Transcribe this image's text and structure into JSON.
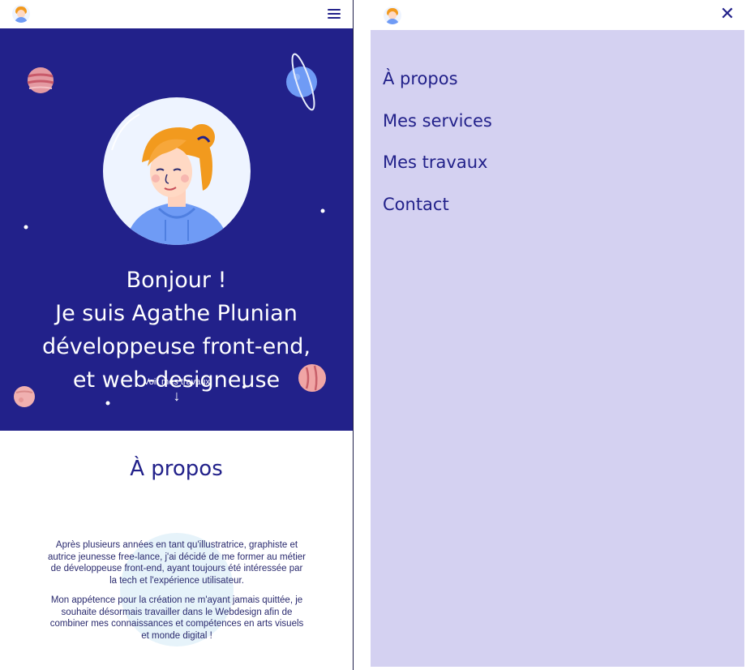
{
  "left_page": {
    "hero": {
      "lines": [
        "Bonjour !",
        "Je suis Agathe Plunian",
        "développeuse front-end,",
        "et web-designeuse"
      ],
      "cta_label": "Voir mes travaux",
      "cta_arrow": "↓"
    },
    "about": {
      "title": "À propos",
      "paragraphs": [
        "Après plusieurs années en tant qu'illustratrice, graphiste et autrice jeunesse free-lance, j'ai décidé de me former au métier de développeuse front-end, ayant toujours été intéressée par la tech et l'expérience utilisateur.",
        "Mon appétence pour la création ne m'ayant jamais quittée, je souhaite désormais travailler dans le Webdesign afin de combiner mes connaissances et compétences en arts visuels et monde digital !"
      ]
    }
  },
  "right_menu": {
    "close_icon": "✕",
    "items": [
      "À propos",
      "Mes services",
      "Mes travaux",
      "Contact"
    ]
  },
  "colors": {
    "navy": "#22218a",
    "menu_bg": "#d4d1f1",
    "about_blob": "#e6f3fa"
  },
  "icons": {
    "logo": "avatar-logo-icon",
    "menu": "hamburger-menu-icon",
    "close": "close-icon",
    "cta": "arrow-down-icon"
  }
}
